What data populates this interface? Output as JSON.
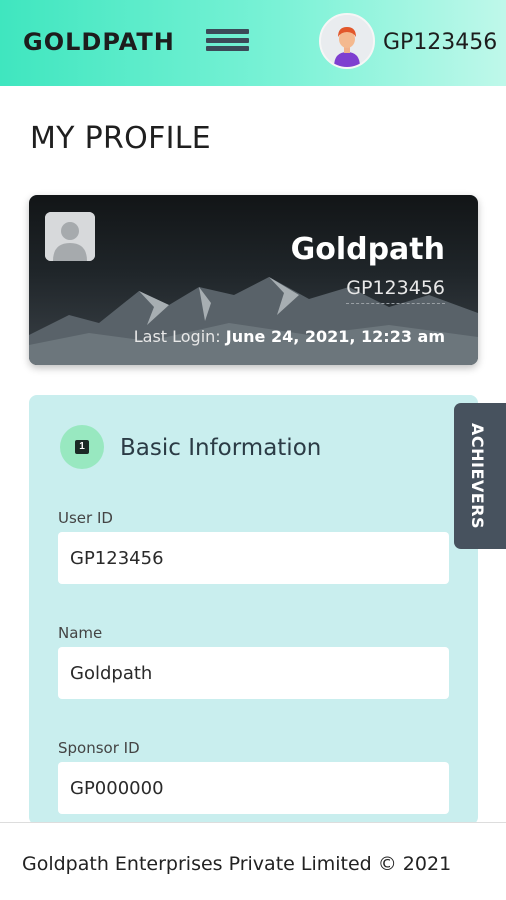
{
  "header": {
    "brand": "GOLDPATH",
    "user_code": "GP123456"
  },
  "page": {
    "title": "MY PROFILE"
  },
  "profile_card": {
    "name": "Goldpath",
    "user_id": "GP123456",
    "last_login_label": "Last Login:",
    "last_login_value": "June 24, 2021, 12:23 am"
  },
  "basic_info": {
    "step_number": "1",
    "title": "Basic Information",
    "fields": [
      {
        "label": "User ID",
        "value": "GP123456"
      },
      {
        "label": "Name",
        "value": "Goldpath"
      },
      {
        "label": "Sponsor ID",
        "value": "GP000000"
      }
    ]
  },
  "side_tab": {
    "label": "ACHIEVERS"
  },
  "footer": {
    "text": "Goldpath Enterprises Private Limited © 2021"
  },
  "colors": {
    "header_gradient_start": "#3fe6bf",
    "panel_bg": "#c9eeee",
    "side_tab_bg": "#47525e",
    "step_badge_bg": "#98e8c0"
  }
}
